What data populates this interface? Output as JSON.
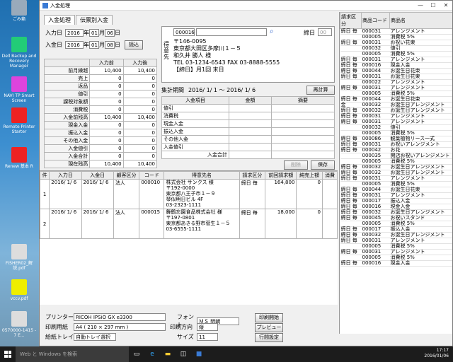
{
  "desktop": {
    "icons": [
      {
        "label": "ごみ箱",
        "color": "#9ab"
      },
      {
        "label": "Dell Backup and Recovery Manager",
        "color": "#2c7"
      },
      {
        "label": "NAVI TP Smart Screen",
        "color": "#d4d"
      },
      {
        "label": "Remote Printer Starter",
        "color": "#e22"
      },
      {
        "label": "Renew 基本 R",
        "color": "#e22"
      },
      {
        "label": "FISHER02_解説.pdf",
        "color": "#ddd"
      },
      {
        "label": "vccv.pdf",
        "color": "#ee0"
      },
      {
        "label": "0570000-1415 - 7 E...",
        "color": "#ddd"
      }
    ]
  },
  "window": {
    "title": "入金処理",
    "min": "—",
    "max": "☐",
    "close": "✕"
  },
  "tabs": [
    "入金処理",
    "伝票別入金"
  ],
  "dates": {
    "input_label": "入力日",
    "input_y": "2016",
    "input_m": "01",
    "input_d": "06",
    "pay_label": "入金日",
    "pay_y": "2016",
    "pay_m": "01",
    "pay_d": "08",
    "year": "年",
    "month": "月",
    "day": "日",
    "read_btn": "読込"
  },
  "customer": {
    "code": "000016",
    "side_label": "得意先",
    "close_label": "締日",
    "close_value": "00",
    "lines": [
      "〒146-0095",
      "東京都大田区多摩川１－５",
      "和久井 勝人 様",
      "TEL 03-1234-6543 FAX 03-8888-5555",
      "【締日】月1回 末日"
    ]
  },
  "summary": {
    "h_before": "入力前",
    "h_after": "入力後",
    "rows": [
      {
        "label": "前月繰越",
        "before": "10,400",
        "after": "10,400"
      },
      {
        "label": "売上",
        "before": "0",
        "after": "0"
      },
      {
        "label": "返品",
        "before": "0",
        "after": "0"
      },
      {
        "label": "値引",
        "before": "0",
        "after": "0"
      },
      {
        "label": "課税対象額",
        "before": "0",
        "after": "0"
      },
      {
        "label": "消費税",
        "before": "0",
        "after": "0"
      },
      {
        "label": "入金前残高",
        "before": "10,400",
        "after": "10,400"
      },
      {
        "label": "現金入金",
        "before": "0",
        "after": "0"
      },
      {
        "label": "振込入金",
        "before": "0",
        "after": "0"
      },
      {
        "label": "その他入金",
        "before": "0",
        "after": "0"
      },
      {
        "label": "入金値引",
        "before": "0",
        "after": "0"
      },
      {
        "label": "入金合計",
        "before": "0",
        "after": "0"
      },
      {
        "label": "現在残高",
        "before": "10,400",
        "after": "10,400"
      }
    ]
  },
  "period": {
    "label": "集計期間",
    "value": "2016/ 1/ 1 〜 2016/ 1/ 6",
    "recalc": "再計算"
  },
  "entry": {
    "h_item": "入金項目",
    "h_amount": "金額",
    "h_memo": "摘要",
    "rows": [
      "値引",
      "消費税",
      "現金入金",
      "振込入金",
      "その他入金",
      "入金値引"
    ],
    "total_label": "入金合計",
    "delete_btn": "削除",
    "save_btn": "保存"
  },
  "list": {
    "headers": [
      "件",
      "入力日",
      "入金日",
      "顧客区分",
      "コード",
      "得意先名",
      "請求区分",
      "前回請求額",
      "純売上額",
      "消費"
    ],
    "rows": [
      {
        "no": "1",
        "input": "2016/ 1/ 6",
        "pay": "2016/ 1/ 6",
        "kind": "法人",
        "code": "000010",
        "name": [
          "株式会社 サンクス 様",
          "〒192-0000",
          "東京都八王子市１－９",
          "琴似明日ビル 4F",
          "03-2323-1111"
        ],
        "billing": "締日 毎",
        "prev": "164,800",
        "net": "0"
      },
      {
        "no": "2",
        "input": "2016/ 1/ 6",
        "pay": "2016/ 1/ 6",
        "kind": "法人",
        "code": "000015",
        "name": [
          "舞鶴忘園食品株式会社 様",
          "〒197-0801",
          "東京都あきる野市菅生１－５",
          "03-6555-1111"
        ],
        "billing": "締日 毎",
        "prev": "18,000",
        "net": "0"
      }
    ]
  },
  "print": {
    "printer_label": "プリンター",
    "printer": "RICOH IPSiO GX e3300",
    "paper_label": "印刷用紙",
    "paper": "A4 ( 210 × 297 mm )",
    "tray_label": "給紙トレイ",
    "tray": "自動トレイ選択",
    "font_label": "フォント",
    "font": "ＭＳ 明朝",
    "dir_label": "印刷方向",
    "dir": "縦",
    "size_label": "サイズ",
    "size": "11",
    "start_btn": "印刷開始",
    "preview_btn": "プレビュー",
    "setup_btn": "行間設定"
  },
  "rightlist": {
    "headers": [
      "請求区分",
      "商品コード",
      "商品名"
    ],
    "rows": [
      {
        "k": "締日 毎",
        "code": "000031",
        "name": "アレンジメント"
      },
      {
        "k": "",
        "code": "000005",
        "name": "消費税 5%"
      },
      {
        "k": "締日 毎",
        "code": "000031",
        "name": "お祝い花束"
      },
      {
        "k": "",
        "code": "000032",
        "name": "値引"
      },
      {
        "k": "",
        "code": "000005",
        "name": "消費税 5%"
      },
      {
        "k": "締日 毎",
        "code": "000031",
        "name": "アレンジメント"
      },
      {
        "k": "締日 毎",
        "code": "000016",
        "name": "現金入金"
      },
      {
        "k": "締日 毎",
        "code": "000044",
        "name": "お誕生日花束"
      },
      {
        "k": "締日 毎",
        "code": "000031",
        "name": "お誕生日花束"
      },
      {
        "k": "",
        "code": "000022",
        "name": "アレンジメント"
      },
      {
        "k": "締日 毎",
        "code": "000031",
        "name": "アレンジメント"
      },
      {
        "k": "",
        "code": "000005",
        "name": "消費税 5%"
      },
      {
        "k": "締日 毎",
        "code": "000044",
        "name": "お誕生日花束"
      },
      {
        "k": "金",
        "code": "000032",
        "name": "お誕生日アレンジメント"
      },
      {
        "k": "締日 毎",
        "code": "000032",
        "name": "お誕生日アレンジメント"
      },
      {
        "k": "締日 毎",
        "code": "000031",
        "name": "アレンジメント"
      },
      {
        "k": "締日 毎",
        "code": "000031",
        "name": "アレンジメント"
      },
      {
        "k": "",
        "code": "000032",
        "name": "値引"
      },
      {
        "k": "",
        "code": "000005",
        "name": "消費税 5%"
      },
      {
        "k": "締日 毎",
        "code": "000086",
        "name": "観葉植物リース一式"
      },
      {
        "k": "締日 毎",
        "code": "000031",
        "name": "お祝いアレンジメント"
      },
      {
        "k": "締日 毎",
        "code": "000042",
        "name": "お花"
      },
      {
        "k": "",
        "code": "000035",
        "name": "開店お祝いアレンジメント"
      },
      {
        "k": "",
        "code": "000005",
        "name": "消費税 5%"
      },
      {
        "k": "締日 毎",
        "code": "000032",
        "name": "お誕生日アレンジメント"
      },
      {
        "k": "締日 毎",
        "code": "000032",
        "name": "お誕生日アレンジメント"
      },
      {
        "k": "締日 毎",
        "code": "000031",
        "name": "アレンジメント"
      },
      {
        "k": "",
        "code": "000005",
        "name": "消費税 5%"
      },
      {
        "k": "締日 毎",
        "code": "000044",
        "name": "お誕生日花束"
      },
      {
        "k": "締日 毎",
        "code": "000031",
        "name": "アレンジメント"
      },
      {
        "k": "締日 毎",
        "code": "000017",
        "name": "振込入金"
      },
      {
        "k": "締日 毎",
        "code": "000016",
        "name": "現金入金"
      },
      {
        "k": "締日 毎",
        "code": "000032",
        "name": "お誕生日アレンジメント"
      },
      {
        "k": "締日 毎",
        "code": "000045",
        "name": "お祝いスタンド"
      },
      {
        "k": "",
        "code": "000005",
        "name": "消費税 5%"
      },
      {
        "k": "締日 毎",
        "code": "000017",
        "name": "振込入金"
      },
      {
        "k": "締日 毎",
        "code": "000032",
        "name": "お誕生日アレンジメント"
      },
      {
        "k": "締日 毎",
        "code": "000031",
        "name": "アレンジメント"
      },
      {
        "k": "",
        "code": "000005",
        "name": "消費税 5%"
      },
      {
        "k": "締日 毎",
        "code": "000031",
        "name": "アレンジメント"
      },
      {
        "k": "",
        "code": "000005",
        "name": "消費税 5%"
      },
      {
        "k": "締日 毎",
        "code": "000016",
        "name": "現金入金"
      }
    ]
  },
  "taskbar": {
    "search": "Web と Windows を検索",
    "time": "17:17",
    "date": "2016/01/06"
  }
}
